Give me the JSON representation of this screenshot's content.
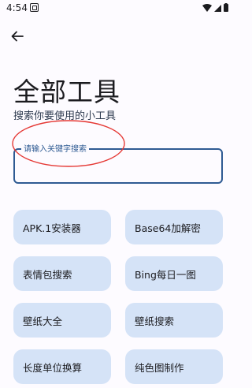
{
  "status_bar": {
    "time": "4:54"
  },
  "header": {
    "title": "全部工具",
    "subtitle": "搜索你要使用的小工具"
  },
  "search": {
    "label": "请输入关键字搜索",
    "value": ""
  },
  "tools": [
    {
      "label": "APK.1安装器"
    },
    {
      "label": "Base64加解密"
    },
    {
      "label": "表情包搜索"
    },
    {
      "label": "Bing每日一图"
    },
    {
      "label": "壁纸大全"
    },
    {
      "label": "壁纸搜索"
    },
    {
      "label": "长度单位换算"
    },
    {
      "label": "纯色图制作"
    }
  ],
  "colors": {
    "accent": "#2f5b93",
    "chip_bg": "#d5e3f7",
    "annotation": "#e53935"
  }
}
